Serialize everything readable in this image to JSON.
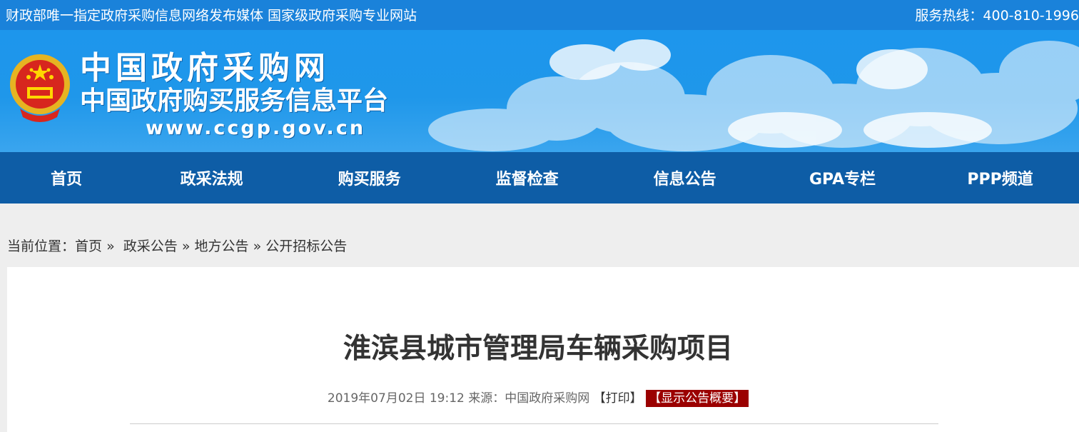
{
  "topbar": {
    "slogan": "财政部唯一指定政府采购信息网络发布媒体 国家级政府采购专业网站",
    "hotline": "服务热线：400-810-1996"
  },
  "header": {
    "title": "中国政府采购网",
    "subtitle": "中国政府购买服务信息平台",
    "url": "www.ccgp.gov.cn"
  },
  "nav": {
    "items": [
      {
        "label": "首页"
      },
      {
        "label": "政采法规"
      },
      {
        "label": "购买服务"
      },
      {
        "label": "监督检查"
      },
      {
        "label": "信息公告"
      },
      {
        "label": "GPA专栏"
      },
      {
        "label": "PPP频道"
      }
    ]
  },
  "breadcrumb": {
    "prefix": "当前位置：",
    "items": [
      "首页",
      "政采公告",
      "地方公告",
      "公开招标公告"
    ],
    "separator": "»"
  },
  "article": {
    "title": "淮滨县城市管理局车辆采购项目",
    "date": "2019年07月02日 19:12",
    "source_label": "来源：",
    "source": "中国政府采购网",
    "print_label": "【打印】",
    "summary_button": "【显示公告概要】"
  },
  "colors": {
    "topbar": "#1a82da",
    "nav": "#0e5da6",
    "summary_button": "#9b0000"
  }
}
